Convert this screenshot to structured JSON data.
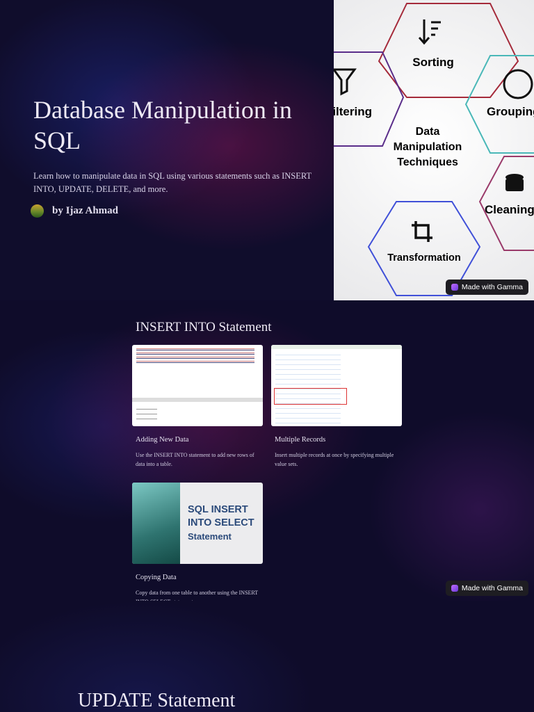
{
  "hero": {
    "title": "Database Manipulation in SQL",
    "subtitle": "Learn how to manipulate data in SQL using various statements such as INSERT INTO, UPDATE, DELETE, and more.",
    "author": "by Ijaz Ahmad",
    "diagram": {
      "center": [
        "Data",
        "Manipulation",
        "Techniques"
      ],
      "nodes": [
        "Sorting",
        "Filtering",
        "Grouping",
        "Cleaning",
        "Transformation"
      ]
    }
  },
  "badge": "Made with Gamma",
  "insert": {
    "title": "INSERT INTO Statement",
    "cards": [
      {
        "title": "Adding New Data",
        "desc": "Use the INSERT INTO statement to add new rows of data into a table."
      },
      {
        "title": "Multiple Records",
        "desc": "Insert multiple records at once by specifying multiple value sets."
      },
      {
        "title": "Copying Data",
        "desc": "Copy data from one table to another using the INSERT INTO SELECT statement.",
        "image_text": [
          "SQL INSERT",
          "INTO SELECT",
          "Statement"
        ]
      }
    ]
  },
  "update": {
    "title": "UPDATE Statement"
  }
}
